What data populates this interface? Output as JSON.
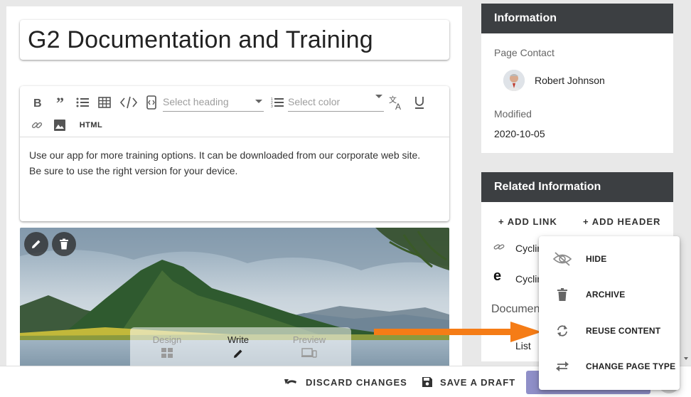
{
  "page": {
    "title": "G2 Documentation and Training"
  },
  "editor": {
    "heading_placeholder": "Select heading",
    "color_placeholder": "Select color",
    "html_label": "HTML",
    "body_line1": "Use our app for more training options. It can be downloaded from our corporate web site.",
    "body_line2": "Be sure to use the right version for your device."
  },
  "image": {
    "modes": [
      {
        "label": "Design",
        "icon": "design-grid-icon"
      },
      {
        "label": "Write",
        "icon": "pencil-icon"
      },
      {
        "label": "Preview",
        "icon": "devices-icon"
      }
    ]
  },
  "info": {
    "header": "Information",
    "contact_label": "Page Contact",
    "contact_name": "Robert Johnson",
    "modified_label": "Modified",
    "modified_value": "2020-10-05"
  },
  "related": {
    "header": "Related Information",
    "add_link": "+ ADD LINK",
    "add_header": "+ ADD HEADER",
    "items": [
      {
        "label": "Cyclin",
        "icon": "link-icon"
      },
      {
        "label": "Cyclin",
        "icon": "edge-browser-icon"
      }
    ],
    "section_label": "Documen",
    "sub_label": "List"
  },
  "context_menu": {
    "items": [
      {
        "label": "HIDE",
        "icon": "eye-off-icon"
      },
      {
        "label": "ARCHIVE",
        "icon": "trash-icon"
      },
      {
        "label": "REUSE CONTENT",
        "icon": "refresh-icon"
      },
      {
        "label": "CHANGE PAGE TYPE",
        "icon": "swap-icon"
      }
    ]
  },
  "bottom_bar": {
    "discard": "DISCARD CHANGES",
    "save_draft": "SAVE A DRAFT"
  },
  "colors": {
    "header_bg": "#3c3f42",
    "callout_arrow": "#f57c16",
    "primary_button": "#8f8fc8"
  }
}
